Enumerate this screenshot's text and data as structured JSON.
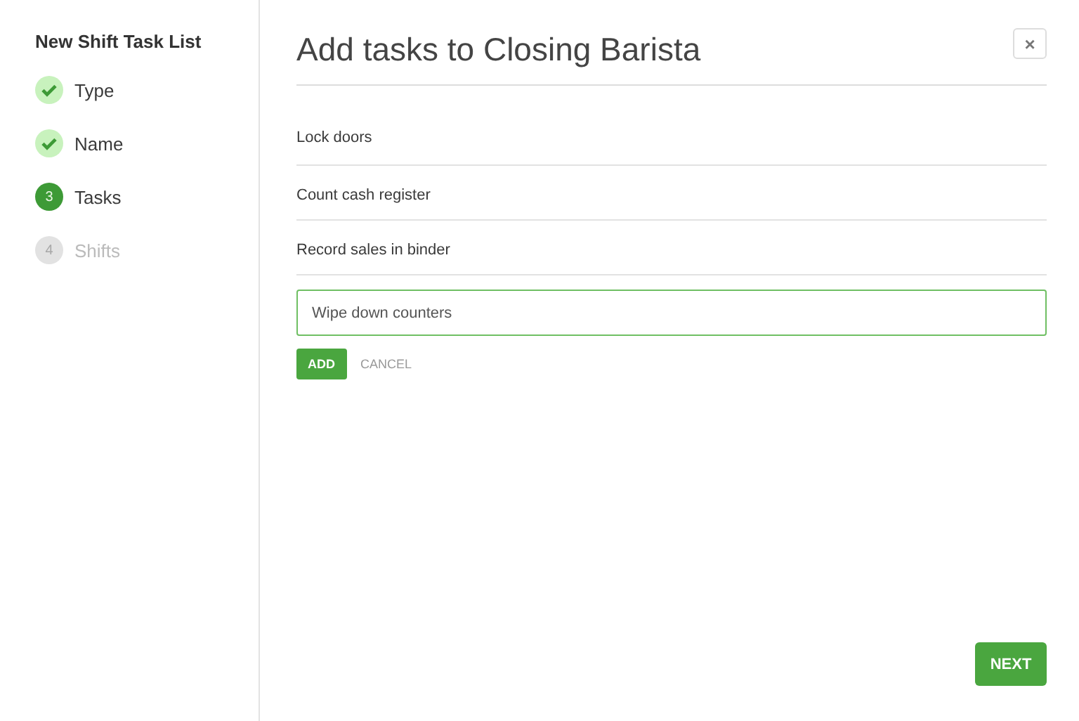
{
  "sidebar": {
    "title": "New Shift Task List",
    "steps": [
      {
        "label": "Type",
        "kind": "done"
      },
      {
        "label": "Name",
        "kind": "done"
      },
      {
        "label": "Tasks",
        "number": "3",
        "kind": "current"
      },
      {
        "label": "Shifts",
        "number": "4",
        "kind": "pending"
      }
    ]
  },
  "main": {
    "title": "Add tasks to Closing Barista",
    "close": "×",
    "tasks": [
      "Lock doors",
      "Count cash register",
      "Record sales in binder"
    ],
    "new_task": {
      "value": "Wipe down counters"
    },
    "buttons": {
      "add": "ADD",
      "cancel": "CANCEL",
      "next": "NEXT"
    }
  }
}
